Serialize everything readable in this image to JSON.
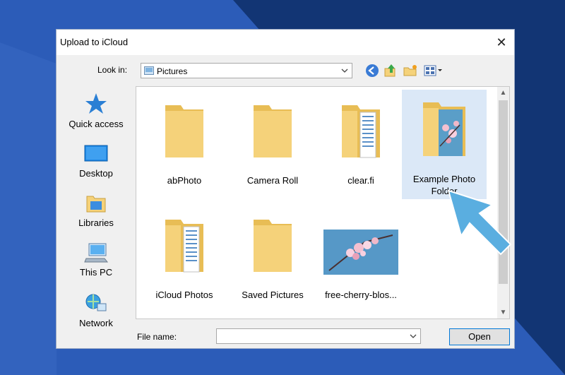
{
  "dialog": {
    "title": "Upload to iCloud",
    "close_glyph": "✕"
  },
  "lookin": {
    "label": "Look in:",
    "value": "Pictures",
    "toolbar_icons": [
      "back-icon",
      "up-folder-icon",
      "new-folder-icon",
      "view-menu-icon"
    ]
  },
  "places": [
    {
      "label": "Quick access",
      "icon": "star-icon"
    },
    {
      "label": "Desktop",
      "icon": "desktop-icon"
    },
    {
      "label": "Libraries",
      "icon": "libraries-icon"
    },
    {
      "label": "This PC",
      "icon": "computer-icon"
    },
    {
      "label": "Network",
      "icon": "network-icon"
    }
  ],
  "items": [
    {
      "name": "abPhoto",
      "icon": "folder-icon"
    },
    {
      "name": "Camera Roll",
      "icon": "folder-icon"
    },
    {
      "name": "clear.fi",
      "icon": "folder-with-pages-icon"
    },
    {
      "name": "Example Photo Folder",
      "visible_name": "Example Photo\nFolder",
      "icon": "folder-with-photo-icon",
      "selected": true
    },
    {
      "name": "iCloud Photos",
      "icon": "folder-with-pages-icon"
    },
    {
      "name": "Saved Pictures",
      "icon": "folder-icon"
    },
    {
      "name": "free-cherry-blos...",
      "icon": "cherry-blossom-thumbnail"
    }
  ],
  "footer": {
    "filename_label": "File name:",
    "filename_value": "",
    "open_label": "Open"
  },
  "colors": {
    "folder": "#f5d27a",
    "folder_dark": "#e8bd55",
    "selection": "#dbe8f7",
    "pointer_arrow": "#5aaee0"
  }
}
